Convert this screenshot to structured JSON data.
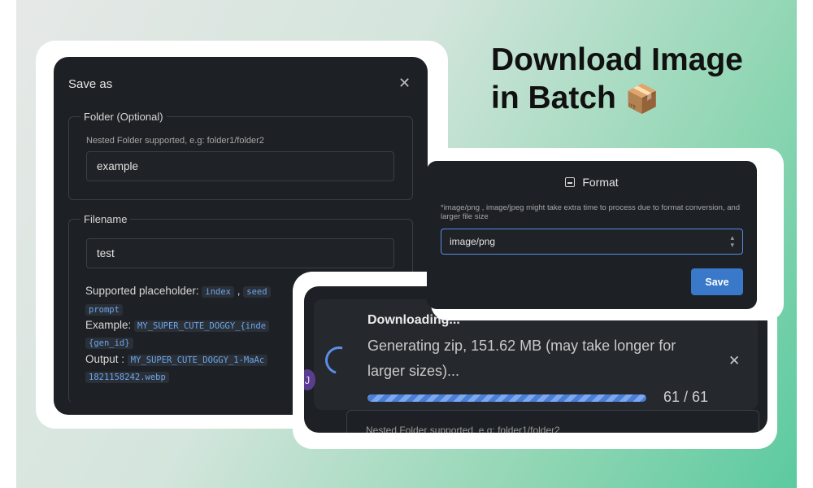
{
  "headline": {
    "line1": "Download Image",
    "line2": "in Batch",
    "emoji": "📦"
  },
  "save_as": {
    "title": "Save as",
    "folder": {
      "legend": "Folder (Optional)",
      "hint": "Nested Folder supported, e.g: folder1/folder2",
      "value": "example"
    },
    "filename": {
      "legend": "Filename",
      "value": "test",
      "placeholder_label": "Supported placeholder:",
      "placeholder_chip1": "index",
      "placeholder_chip2": "seed",
      "placeholder_chip3": "prompt",
      "example_label": "Example:",
      "example_chip1": "MY_SUPER_CUTE_DOGGY_{inde",
      "example_chip2": "{gen_id}",
      "output_label": "Output :",
      "output_chip1": "MY_SUPER_CUTE_DOGGY_1-MaAc",
      "output_chip2": "1821158242.webp"
    }
  },
  "download": {
    "title": "Downloading...",
    "message": "Generating zip, 151.62 MB (may take longer for larger sizes)...",
    "current": 61,
    "total": 61,
    "count_text": "61 / 61",
    "progress": 1.0,
    "avatar_letter": "J",
    "behind_text": "Nested Folder supported, e.g: folder1/folder2"
  },
  "format": {
    "title": "Format",
    "note": "*image/png , image/jpeg might take extra time to process due to format conversion, and larger file size",
    "selected": "image/png",
    "save_label": "Save"
  },
  "colors": {
    "accent": "#3a78c9",
    "panel": "#1d2024",
    "bg_gradient_end": "#5ccaa0"
  }
}
